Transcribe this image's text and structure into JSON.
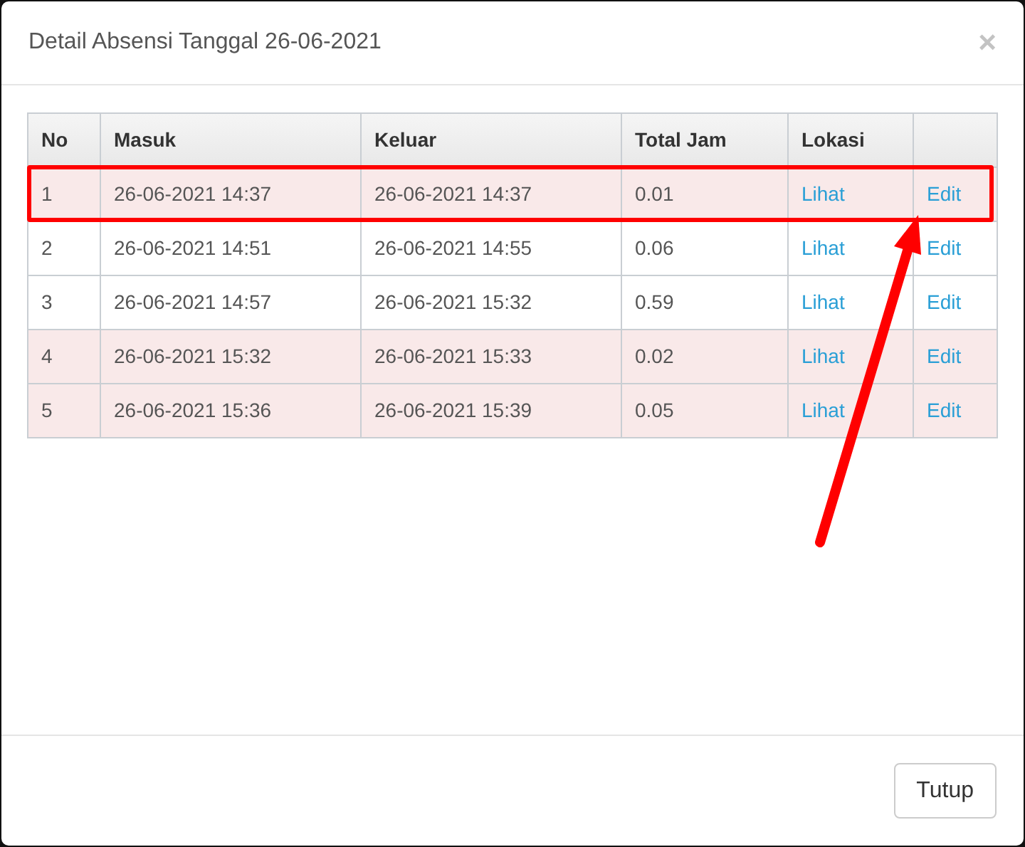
{
  "modal": {
    "title": "Detail Absensi Tanggal 26-06-2021",
    "close": "×"
  },
  "table": {
    "columns": [
      "No",
      "Masuk",
      "Keluar",
      "Total Jam",
      "Lokasi"
    ],
    "rows": [
      {
        "no": "1",
        "masuk": "26-06-2021 14:37",
        "keluar": "26-06-2021 14:37",
        "total_jam": "0.01",
        "lokasi": "Lihat",
        "action": "Edit",
        "highlighted": true,
        "annotated": true
      },
      {
        "no": "2",
        "masuk": "26-06-2021 14:51",
        "keluar": "26-06-2021 14:55",
        "total_jam": "0.06",
        "lokasi": "Lihat",
        "action": "Edit",
        "highlighted": false,
        "annotated": false
      },
      {
        "no": "3",
        "masuk": "26-06-2021 14:57",
        "keluar": "26-06-2021 15:32",
        "total_jam": "0.59",
        "lokasi": "Lihat",
        "action": "Edit",
        "highlighted": false,
        "annotated": false
      },
      {
        "no": "4",
        "masuk": "26-06-2021 15:32",
        "keluar": "26-06-2021 15:33",
        "total_jam": "0.02",
        "lokasi": "Lihat",
        "action": "Edit",
        "highlighted": true,
        "annotated": false
      },
      {
        "no": "5",
        "masuk": "26-06-2021 15:36",
        "keluar": "26-06-2021 15:39",
        "total_jam": "0.05",
        "lokasi": "Lihat",
        "action": "Edit",
        "highlighted": true,
        "annotated": false
      }
    ]
  },
  "footer": {
    "button": "Tutup"
  }
}
